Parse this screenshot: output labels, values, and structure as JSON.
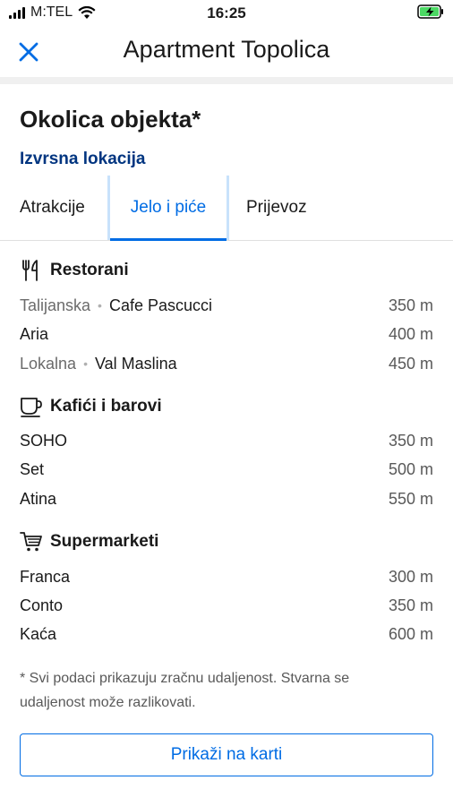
{
  "status_bar": {
    "carrier": "M:TEL",
    "time": "16:25"
  },
  "header": {
    "title": "Apartment Topolica",
    "close_icon": "close-icon"
  },
  "section": {
    "title": "Okolica objekta*",
    "location_link": "Izvrsna lokacija"
  },
  "tabs": [
    {
      "label": "Atrakcije",
      "active": false
    },
    {
      "label": "Jelo i piće",
      "active": true
    },
    {
      "label": "Prijevoz",
      "active": false
    }
  ],
  "categories": [
    {
      "title": "Restorani",
      "icon": "cutlery-icon",
      "items": [
        {
          "tag": "Talijanska",
          "name": "Cafe Pascucci",
          "distance": "350 m"
        },
        {
          "tag": "",
          "name": "Aria",
          "distance": "400 m"
        },
        {
          "tag": "Lokalna",
          "name": "Val Maslina",
          "distance": "450 m"
        }
      ]
    },
    {
      "title": "Kafići i barovi",
      "icon": "coffee-cup-icon",
      "items": [
        {
          "tag": "",
          "name": "SOHO",
          "distance": "350 m"
        },
        {
          "tag": "",
          "name": "Set",
          "distance": "500 m"
        },
        {
          "tag": "",
          "name": "Atina",
          "distance": "550 m"
        }
      ]
    },
    {
      "title": "Supermarketi",
      "icon": "shopping-cart-icon",
      "items": [
        {
          "tag": "",
          "name": "Franca",
          "distance": "300 m"
        },
        {
          "tag": "",
          "name": "Conto",
          "distance": "350 m"
        },
        {
          "tag": "",
          "name": "Kaća",
          "distance": "600 m"
        }
      ]
    }
  ],
  "footnote": "* Svi podaci prikazuju zračnu udaljenost. Stvarna se udaljenost može razlikovati.",
  "map_button": "Prikaži na karti",
  "colors": {
    "accent": "#006ce4",
    "link": "#003580",
    "tab_border": "#c8e2fb"
  }
}
